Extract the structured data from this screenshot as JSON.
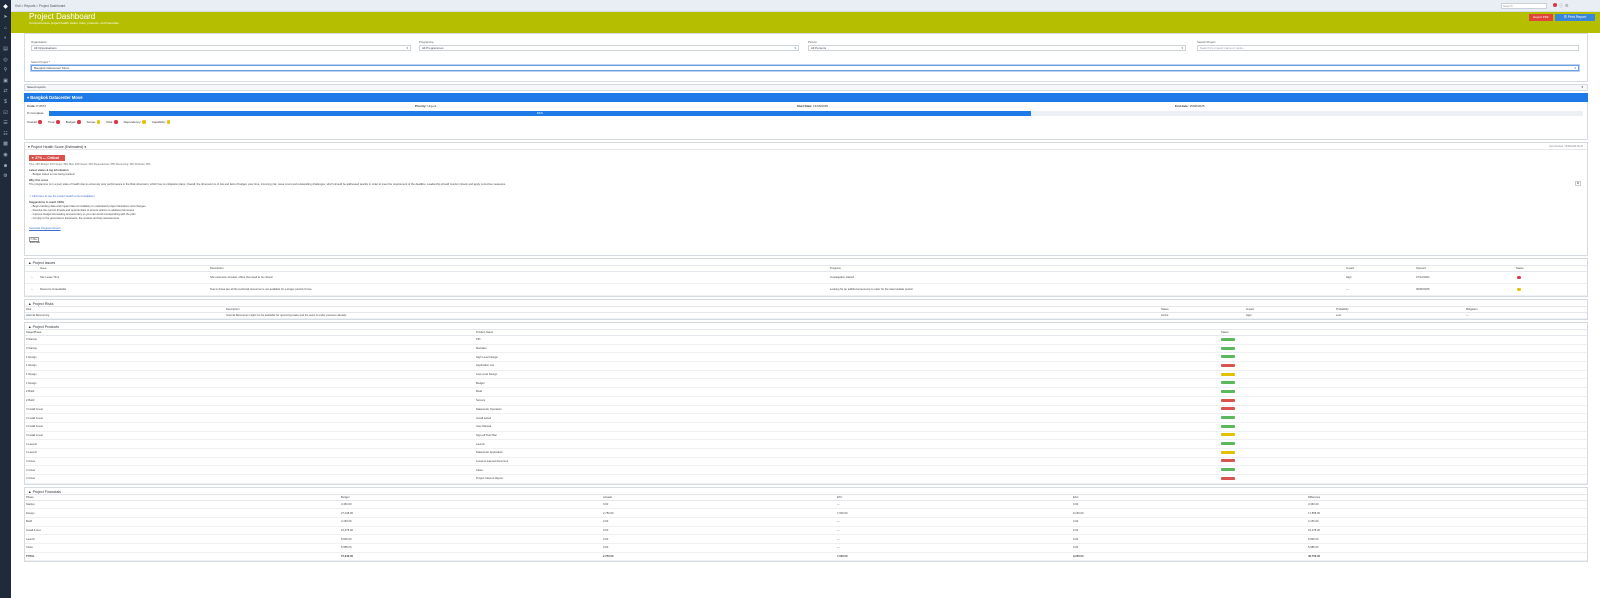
{
  "topbar": {
    "breadcrumb": "Gvil  >  Reports  >  Project Dashboard",
    "search_placeholder": "Search"
  },
  "banner": {
    "title": "Project Dashboard",
    "subtitle": "Comprehensive project health status, risks, products, and financials",
    "export_label": "Export PDF",
    "print_label": "☰ Print Report"
  },
  "filters": {
    "organisation": {
      "label": "Organisation",
      "value": "All Organisations"
    },
    "programme": {
      "label": "Programme",
      "value": "All Programmes"
    },
    "person": {
      "label": "Person",
      "value": "All Persons"
    },
    "search": {
      "label": "Search Project",
      "placeholder": "Search by project name or code..."
    },
    "select_project": {
      "label": "Select Project *",
      "value": "Bangkok Datacenter Move"
    }
  },
  "saved_reports": {
    "label": "Saved reports",
    "toggle": "▾"
  },
  "project": {
    "name": "Bangkok Datacenter Move",
    "code_label": "Code:",
    "code": "P-0572",
    "priority_label": "Priority:",
    "priority": "Urgent",
    "start_label": "Start Date:",
    "start": "13/06/2025",
    "end_label": "End date:",
    "end": "15/08/2025",
    "progress_label": "% Complete:",
    "progress": 0.64,
    "progress_text": "64%",
    "rag": [
      {
        "label": "Overall:",
        "color": "red"
      },
      {
        "label": "Time:",
        "color": "red"
      },
      {
        "label": "Budget:",
        "color": "red"
      },
      {
        "label": "Scope:",
        "color": "amber"
      },
      {
        "label": "Risk:",
        "color": "red"
      },
      {
        "label": "Dependency:",
        "color": "amber"
      },
      {
        "label": "Capability:",
        "color": "amber"
      }
    ]
  },
  "health": {
    "title": "Project Health Score (Estimated)",
    "badge": "▼ 27% — Critical",
    "right_note": "Last checked: 13/06/2025 09:15",
    "sub": "Time: 25%   Budget: 20%   Scope: 65%   Risk: 20%   Issues: 30%   Dependencies: 55%   Resourcing: 40%   Products: 45%",
    "section1_title": "Latest status & log information",
    "section1_item": "- Budget status is now being tracked",
    "section2_title": "Why this score",
    "section2_text": "The programme is in a poor state of health due to extremely poor performance in the Risk dimension, which has no mitigation plans. Overall, the dimension is of risk and lack of budget, poor time, incoming risk, issue count and outstanding challenges, which should be addressed quickly in order to meet the requirement of the deadline. Leadership should monitor closely and apply corrective measures.",
    "section2_link": "↗ Click here to see the project health score breakdown",
    "section3_title": "Suggestions to reach 100%",
    "suggestions": [
      "- Begin tracking data and impact data immediately to understand project deviations and changes",
      "- Resolve the current threats and opportunities to ensure actions to address risk issues",
      "- Improve budget forecasting and accuracy so you can avoid overspending with the plan",
      "- Comply to the governance framework, the reviews and key assessments"
    ],
    "more_link": "Generate Progress Report",
    "refresh_label": "↻ Re-Estimate",
    "copy_label": "⧉"
  },
  "issues": {
    "title": "Project Issues",
    "columns": [
      "Issue",
      "Description",
      "Progress",
      "Impact",
      "Opened",
      "Status"
    ],
    "rows": [
      {
        "issue": "Site Lease Time",
        "description": "Site extension of lease, offers that need to be closed.",
        "progress": "Investigation started",
        "impact": "High",
        "opened": "07/12/2024",
        "status": "red"
      },
      {
        "issue": "Resource Unavailable",
        "description": "Due to those are all the technical resources is not available for a longer period of time.",
        "progress": "Looking for an additional resource to cater for the intermediate period.",
        "impact": "—",
        "opened": "06/05/2025",
        "status": "amber"
      }
    ]
  },
  "risks": {
    "title": "Project Risks",
    "columns": [
      "Risk",
      "Description",
      "Status",
      "Impact",
      "Probability",
      "Mitigation"
    ],
    "rows": [
      {
        "risk": "Internal Resourcing",
        "description": "Internal Resources might not be available for upcoming tasks and the team is under pressure already.",
        "status": "Active",
        "impact": "High",
        "probability": "Low",
        "mitigation": "—"
      }
    ]
  },
  "products": {
    "title": "Project Products",
    "columns": [
      "Stage/Phase",
      "Product Name",
      "Status"
    ],
    "rows": [
      {
        "stage": "0 Startup",
        "name": "PID",
        "status": "green"
      },
      {
        "stage": "0 Startup",
        "name": "Mandate",
        "status": "green"
      },
      {
        "stage": "1 Design",
        "name": "High Level Design",
        "status": "green"
      },
      {
        "stage": "1 Design",
        "name": "Application List",
        "status": "red"
      },
      {
        "stage": "1 Design",
        "name": "Low Level Design",
        "status": "amber"
      },
      {
        "stage": "1 Design",
        "name": "Budget",
        "status": "green"
      },
      {
        "stage": "2 Build",
        "name": "Build",
        "status": "green"
      },
      {
        "stage": "2 Build",
        "name": "Servers",
        "status": "red"
      },
      {
        "stage": "3 Install & test",
        "name": "Datacenter Operation",
        "status": "red"
      },
      {
        "stage": "3 Install & test",
        "name": "Install tested",
        "status": "green"
      },
      {
        "stage": "3 Install & test",
        "name": "User Manual",
        "status": "green"
      },
      {
        "stage": "3 Install & test",
        "name": "Sign-off Test Plan",
        "status": "amber"
      },
      {
        "stage": "4 Launch",
        "name": "Launch",
        "status": "green"
      },
      {
        "stage": "4 Launch",
        "name": "Datacenter Application",
        "status": "amber"
      },
      {
        "stage": "4 Close",
        "name": "Lessons learned document",
        "status": "red"
      },
      {
        "stage": "4 Close",
        "name": "Close",
        "status": "green"
      },
      {
        "stage": "4 Close",
        "name": "Project Closure Report",
        "status": "red"
      }
    ]
  },
  "financials": {
    "title": "Project Financials",
    "columns": [
      "Phase",
      "Budget",
      "Actuals",
      "ETC",
      "EAC",
      "Difference"
    ],
    "rows": [
      {
        "phase": "Startup",
        "budget": "3,460.00",
        "actuals": "0.00",
        "etc": "—",
        "eac": "0.00",
        "diff": "3,460.00"
      },
      {
        "phase": "Design",
        "budget": "27,048.00",
        "actuals": "2,750.00",
        "etc": "7,000.00",
        "eac": "9,230.00",
        "diff": "17,858.00"
      },
      {
        "phase": "Build",
        "budget": "4,150.00",
        "actuals": "0.00",
        "etc": "—",
        "eac": "0.00",
        "diff": "4,150.00"
      },
      {
        "phase": "Install & test",
        "budget": "10,478.00",
        "actuals": "0.00",
        "etc": "—",
        "eac": "0.00",
        "diff": "10,478.00"
      },
      {
        "phase": "Launch",
        "budget": "6,825.00",
        "actuals": "0.00",
        "etc": "—",
        "eac": "0.00",
        "diff": "6,825.00"
      },
      {
        "phase": "Close",
        "budget": "5,985.00",
        "actuals": "0.00",
        "etc": "—",
        "eac": "0.00",
        "diff": "5,985.00"
      }
    ],
    "total": {
      "phase": "TOTAL",
      "budget": "57,946.00",
      "actuals": "2,750.00",
      "etc": "7,000.00",
      "eac": "9,230.00",
      "diff": "48,756.00"
    }
  }
}
